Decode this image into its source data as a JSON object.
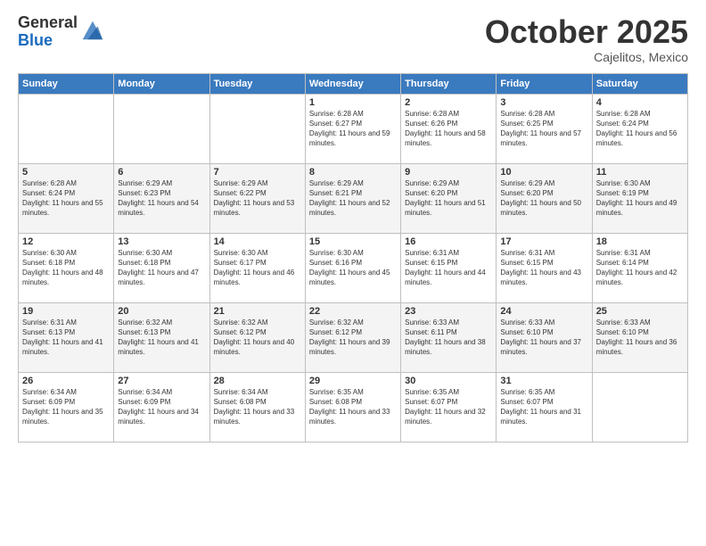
{
  "header": {
    "logo_general": "General",
    "logo_blue": "Blue",
    "month": "October 2025",
    "location": "Cajelitos, Mexico"
  },
  "weekdays": [
    "Sunday",
    "Monday",
    "Tuesday",
    "Wednesday",
    "Thursday",
    "Friday",
    "Saturday"
  ],
  "weeks": [
    [
      {
        "day": "",
        "sunrise": "",
        "sunset": "",
        "daylight": ""
      },
      {
        "day": "",
        "sunrise": "",
        "sunset": "",
        "daylight": ""
      },
      {
        "day": "",
        "sunrise": "",
        "sunset": "",
        "daylight": ""
      },
      {
        "day": "1",
        "sunrise": "Sunrise: 6:28 AM",
        "sunset": "Sunset: 6:27 PM",
        "daylight": "Daylight: 11 hours and 59 minutes."
      },
      {
        "day": "2",
        "sunrise": "Sunrise: 6:28 AM",
        "sunset": "Sunset: 6:26 PM",
        "daylight": "Daylight: 11 hours and 58 minutes."
      },
      {
        "day": "3",
        "sunrise": "Sunrise: 6:28 AM",
        "sunset": "Sunset: 6:25 PM",
        "daylight": "Daylight: 11 hours and 57 minutes."
      },
      {
        "day": "4",
        "sunrise": "Sunrise: 6:28 AM",
        "sunset": "Sunset: 6:24 PM",
        "daylight": "Daylight: 11 hours and 56 minutes."
      }
    ],
    [
      {
        "day": "5",
        "sunrise": "Sunrise: 6:28 AM",
        "sunset": "Sunset: 6:24 PM",
        "daylight": "Daylight: 11 hours and 55 minutes."
      },
      {
        "day": "6",
        "sunrise": "Sunrise: 6:29 AM",
        "sunset": "Sunset: 6:23 PM",
        "daylight": "Daylight: 11 hours and 54 minutes."
      },
      {
        "day": "7",
        "sunrise": "Sunrise: 6:29 AM",
        "sunset": "Sunset: 6:22 PM",
        "daylight": "Daylight: 11 hours and 53 minutes."
      },
      {
        "day": "8",
        "sunrise": "Sunrise: 6:29 AM",
        "sunset": "Sunset: 6:21 PM",
        "daylight": "Daylight: 11 hours and 52 minutes."
      },
      {
        "day": "9",
        "sunrise": "Sunrise: 6:29 AM",
        "sunset": "Sunset: 6:20 PM",
        "daylight": "Daylight: 11 hours and 51 minutes."
      },
      {
        "day": "10",
        "sunrise": "Sunrise: 6:29 AM",
        "sunset": "Sunset: 6:20 PM",
        "daylight": "Daylight: 11 hours and 50 minutes."
      },
      {
        "day": "11",
        "sunrise": "Sunrise: 6:30 AM",
        "sunset": "Sunset: 6:19 PM",
        "daylight": "Daylight: 11 hours and 49 minutes."
      }
    ],
    [
      {
        "day": "12",
        "sunrise": "Sunrise: 6:30 AM",
        "sunset": "Sunset: 6:18 PM",
        "daylight": "Daylight: 11 hours and 48 minutes."
      },
      {
        "day": "13",
        "sunrise": "Sunrise: 6:30 AM",
        "sunset": "Sunset: 6:18 PM",
        "daylight": "Daylight: 11 hours and 47 minutes."
      },
      {
        "day": "14",
        "sunrise": "Sunrise: 6:30 AM",
        "sunset": "Sunset: 6:17 PM",
        "daylight": "Daylight: 11 hours and 46 minutes."
      },
      {
        "day": "15",
        "sunrise": "Sunrise: 6:30 AM",
        "sunset": "Sunset: 6:16 PM",
        "daylight": "Daylight: 11 hours and 45 minutes."
      },
      {
        "day": "16",
        "sunrise": "Sunrise: 6:31 AM",
        "sunset": "Sunset: 6:15 PM",
        "daylight": "Daylight: 11 hours and 44 minutes."
      },
      {
        "day": "17",
        "sunrise": "Sunrise: 6:31 AM",
        "sunset": "Sunset: 6:15 PM",
        "daylight": "Daylight: 11 hours and 43 minutes."
      },
      {
        "day": "18",
        "sunrise": "Sunrise: 6:31 AM",
        "sunset": "Sunset: 6:14 PM",
        "daylight": "Daylight: 11 hours and 42 minutes."
      }
    ],
    [
      {
        "day": "19",
        "sunrise": "Sunrise: 6:31 AM",
        "sunset": "Sunset: 6:13 PM",
        "daylight": "Daylight: 11 hours and 41 minutes."
      },
      {
        "day": "20",
        "sunrise": "Sunrise: 6:32 AM",
        "sunset": "Sunset: 6:13 PM",
        "daylight": "Daylight: 11 hours and 41 minutes."
      },
      {
        "day": "21",
        "sunrise": "Sunrise: 6:32 AM",
        "sunset": "Sunset: 6:12 PM",
        "daylight": "Daylight: 11 hours and 40 minutes."
      },
      {
        "day": "22",
        "sunrise": "Sunrise: 6:32 AM",
        "sunset": "Sunset: 6:12 PM",
        "daylight": "Daylight: 11 hours and 39 minutes."
      },
      {
        "day": "23",
        "sunrise": "Sunrise: 6:33 AM",
        "sunset": "Sunset: 6:11 PM",
        "daylight": "Daylight: 11 hours and 38 minutes."
      },
      {
        "day": "24",
        "sunrise": "Sunrise: 6:33 AM",
        "sunset": "Sunset: 6:10 PM",
        "daylight": "Daylight: 11 hours and 37 minutes."
      },
      {
        "day": "25",
        "sunrise": "Sunrise: 6:33 AM",
        "sunset": "Sunset: 6:10 PM",
        "daylight": "Daylight: 11 hours and 36 minutes."
      }
    ],
    [
      {
        "day": "26",
        "sunrise": "Sunrise: 6:34 AM",
        "sunset": "Sunset: 6:09 PM",
        "daylight": "Daylight: 11 hours and 35 minutes."
      },
      {
        "day": "27",
        "sunrise": "Sunrise: 6:34 AM",
        "sunset": "Sunset: 6:09 PM",
        "daylight": "Daylight: 11 hours and 34 minutes."
      },
      {
        "day": "28",
        "sunrise": "Sunrise: 6:34 AM",
        "sunset": "Sunset: 6:08 PM",
        "daylight": "Daylight: 11 hours and 33 minutes."
      },
      {
        "day": "29",
        "sunrise": "Sunrise: 6:35 AM",
        "sunset": "Sunset: 6:08 PM",
        "daylight": "Daylight: 11 hours and 33 minutes."
      },
      {
        "day": "30",
        "sunrise": "Sunrise: 6:35 AM",
        "sunset": "Sunset: 6:07 PM",
        "daylight": "Daylight: 11 hours and 32 minutes."
      },
      {
        "day": "31",
        "sunrise": "Sunrise: 6:35 AM",
        "sunset": "Sunset: 6:07 PM",
        "daylight": "Daylight: 11 hours and 31 minutes."
      },
      {
        "day": "",
        "sunrise": "",
        "sunset": "",
        "daylight": ""
      }
    ]
  ]
}
